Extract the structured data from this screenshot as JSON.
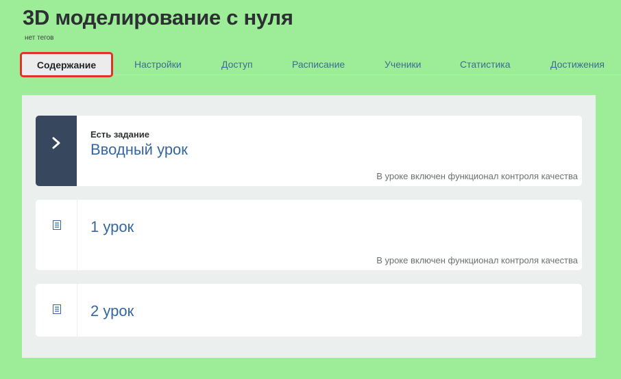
{
  "course": {
    "title": "3D моделирование с нуля",
    "tags": "нет тегов"
  },
  "tabs": [
    {
      "label": "Содержание",
      "active": true
    },
    {
      "label": "Настройки"
    },
    {
      "label": "Доступ"
    },
    {
      "label": "Расписание"
    },
    {
      "label": "Ученики"
    },
    {
      "label": "Статистика"
    },
    {
      "label": "Достижения"
    }
  ],
  "lessons": [
    {
      "badge": "Есть задание",
      "title": "Вводный урок",
      "note": "В уроке включен функционал контроля качества",
      "icon": "chevron-right-icon"
    },
    {
      "title": "1 урок",
      "note": "В уроке включен функционал контроля качества",
      "icon": "document-icon"
    },
    {
      "title": "2 урок",
      "icon": "document-icon"
    }
  ],
  "colors": {
    "background": "#9ded98",
    "panel": "#ebefee",
    "active_outline": "#e0322b",
    "tab_text": "#3e6b93",
    "lesson_title": "#3467a1",
    "dark_side": "#36475e"
  }
}
